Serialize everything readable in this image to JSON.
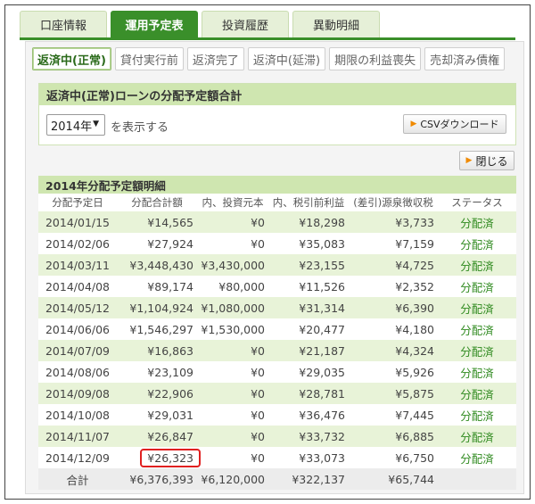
{
  "main_tabs": [
    {
      "label": "口座情報",
      "active": false
    },
    {
      "label": "運用予定表",
      "active": true
    },
    {
      "label": "投資履歴",
      "active": false
    },
    {
      "label": "異動明細",
      "active": false
    }
  ],
  "sub_tabs": [
    {
      "label": "返済中(正常)",
      "active": true
    },
    {
      "label": "貸付実行前",
      "active": false
    },
    {
      "label": "返済完了",
      "active": false
    },
    {
      "label": "返済中(延滞)",
      "active": false
    },
    {
      "label": "期限の利益喪失",
      "active": false
    },
    {
      "label": "売却済み債権",
      "active": false
    }
  ],
  "summary": {
    "title": "返済中(正常)ローンの分配予定額合計",
    "year_select": "2014年",
    "display_label": "を表示する",
    "csv_button": "CSVダウンロード"
  },
  "close_button": "閉じる",
  "detail": {
    "title": "2014年分配予定額明細",
    "columns": [
      "分配予定日",
      "分配合計額",
      "内、投資元本",
      "内、税引前利益",
      "(差引)源泉徴収税",
      "ステータス"
    ],
    "rows": [
      [
        "2014/01/15",
        "¥14,565",
        "¥0",
        "¥18,298",
        "¥3,733",
        "分配済"
      ],
      [
        "2014/02/06",
        "¥27,924",
        "¥0",
        "¥35,083",
        "¥7,159",
        "分配済"
      ],
      [
        "2014/03/11",
        "¥3,448,430",
        "¥3,430,000",
        "¥23,155",
        "¥4,725",
        "分配済"
      ],
      [
        "2014/04/08",
        "¥89,174",
        "¥80,000",
        "¥11,526",
        "¥2,352",
        "分配済"
      ],
      [
        "2014/05/12",
        "¥1,104,924",
        "¥1,080,000",
        "¥31,314",
        "¥6,390",
        "分配済"
      ],
      [
        "2014/06/06",
        "¥1,546,297",
        "¥1,530,000",
        "¥20,477",
        "¥4,180",
        "分配済"
      ],
      [
        "2014/07/09",
        "¥16,863",
        "¥0",
        "¥21,187",
        "¥4,324",
        "分配済"
      ],
      [
        "2014/08/06",
        "¥23,109",
        "¥0",
        "¥29,035",
        "¥5,926",
        "分配済"
      ],
      [
        "2014/09/08",
        "¥22,906",
        "¥0",
        "¥28,781",
        "¥5,875",
        "分配済"
      ],
      [
        "2014/10/08",
        "¥29,031",
        "¥0",
        "¥36,476",
        "¥7,445",
        "分配済"
      ],
      [
        "2014/11/07",
        "¥26,847",
        "¥0",
        "¥33,732",
        "¥6,885",
        "分配済"
      ],
      [
        "2014/12/09",
        "¥26,323",
        "¥0",
        "¥33,073",
        "¥6,750",
        "分配済"
      ]
    ],
    "highlight_row": 11,
    "total": [
      "合計",
      "¥6,376,393",
      "¥6,120,000",
      "¥322,137",
      "¥65,744",
      ""
    ]
  },
  "colors": {
    "accent_green": "#3a8f2a",
    "header_green": "#cfe6b0",
    "row_green": "#e8f3d8",
    "status_green": "#2f8a1f",
    "highlight_red": "#e02020"
  }
}
